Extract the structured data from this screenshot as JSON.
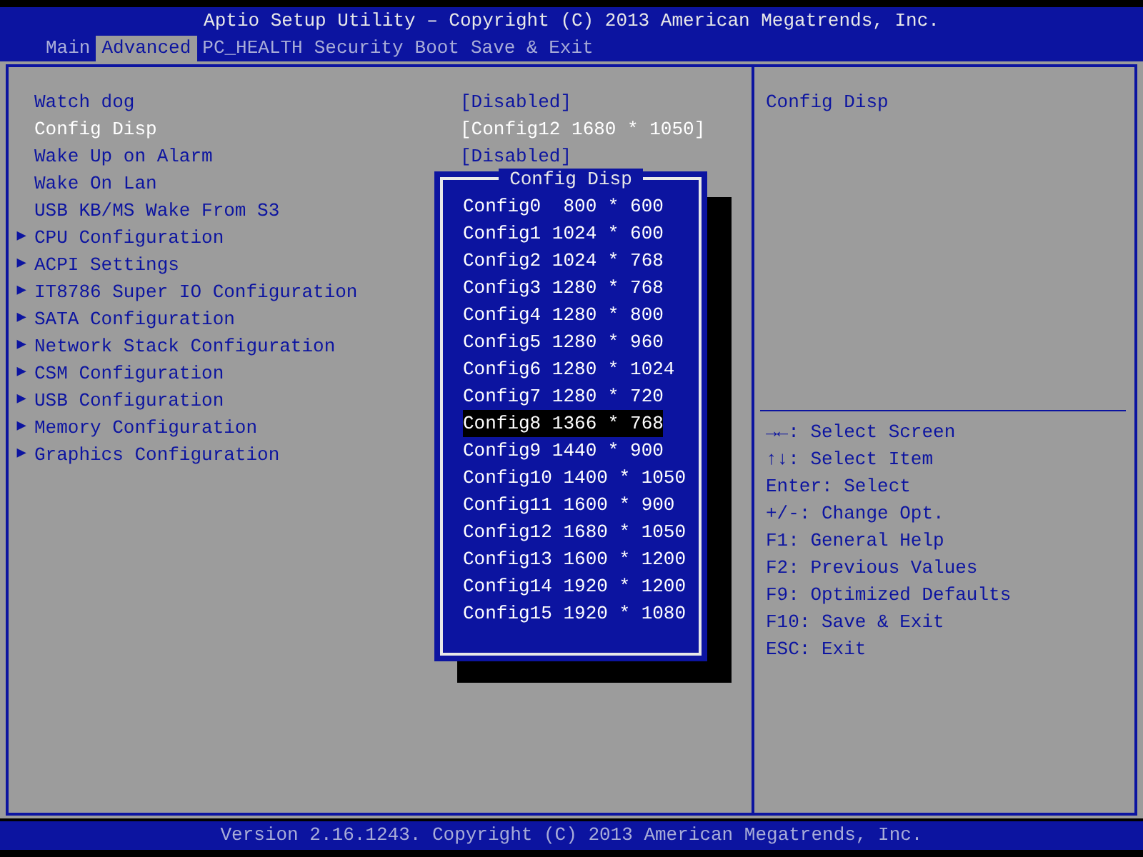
{
  "window": {
    "title": "Aptio Setup Utility – Copyright (C) 2013 American Megatrends, Inc."
  },
  "tabs": [
    {
      "label": "Main",
      "selected": false
    },
    {
      "label": "Advanced",
      "selected": true
    },
    {
      "label": "PC_HEALTH",
      "selected": false
    },
    {
      "label": "Security",
      "selected": false
    },
    {
      "label": "Boot",
      "selected": false
    },
    {
      "label": "Save & Exit",
      "selected": false
    }
  ],
  "settings": [
    {
      "kind": "setting",
      "label": "Watch dog",
      "value": "[Disabled]",
      "selected": false
    },
    {
      "kind": "setting",
      "label": "Config Disp",
      "value": "[Config12 1680 * 1050]",
      "selected": true
    },
    {
      "kind": "setting",
      "label": "Wake Up on Alarm",
      "value": "[Disabled]",
      "selected": false
    },
    {
      "kind": "setting",
      "label": "Wake On Lan",
      "selected": false
    },
    {
      "kind": "setting",
      "label": "USB KB/MS Wake From S3",
      "selected": false
    },
    {
      "kind": "submenu",
      "label": "CPU Configuration",
      "arrow": "▶",
      "selected": false
    },
    {
      "kind": "submenu",
      "label": "ACPI Settings",
      "arrow": "▶",
      "selected": false
    },
    {
      "kind": "submenu",
      "label": "IT8786 Super IO Configuration",
      "arrow": "▶",
      "selected": false
    },
    {
      "kind": "submenu",
      "label": "SATA Configuration",
      "arrow": "▶",
      "selected": false
    },
    {
      "kind": "submenu",
      "label": "Network Stack Configuration",
      "arrow": "▶",
      "selected": false
    },
    {
      "kind": "submenu",
      "label": "CSM Configuration",
      "arrow": "▶",
      "selected": false
    },
    {
      "kind": "submenu",
      "label": "USB Configuration",
      "arrow": "▶",
      "selected": false
    },
    {
      "kind": "submenu",
      "label": "Memory Configuration",
      "arrow": "▶",
      "selected": false
    },
    {
      "kind": "submenu",
      "label": "Graphics Configuration",
      "arrow": "▶",
      "selected": false
    }
  ],
  "popup": {
    "title": "Config Disp",
    "options": [
      {
        "label": "Config0  800 * 600",
        "selected": false
      },
      {
        "label": "Config1 1024 * 600",
        "selected": false
      },
      {
        "label": "Config2 1024 * 768",
        "selected": false
      },
      {
        "label": "Config3 1280 * 768",
        "selected": false
      },
      {
        "label": "Config4 1280 * 800",
        "selected": false
      },
      {
        "label": "Config5 1280 * 960",
        "selected": false
      },
      {
        "label": "Config6 1280 * 1024",
        "selected": false
      },
      {
        "label": "Config7 1280 * 720",
        "selected": false
      },
      {
        "label": "Config8 1366 * 768",
        "selected": true
      },
      {
        "label": "Config9 1440 * 900",
        "selected": false
      },
      {
        "label": "Config10 1400 * 1050",
        "selected": false
      },
      {
        "label": "Config11 1600 * 900",
        "selected": false
      },
      {
        "label": "Config12 1680 * 1050",
        "selected": false
      },
      {
        "label": "Config13 1600 * 1200",
        "selected": false
      },
      {
        "label": "Config14 1920 * 1200",
        "selected": false
      },
      {
        "label": "Config15 1920 * 1080",
        "selected": false
      }
    ]
  },
  "help": {
    "description": "Config Disp",
    "keys": [
      "→←: Select Screen",
      "↑↓: Select Item",
      "Enter: Select",
      "+/-: Change Opt.",
      "F1: General Help",
      "F2: Previous Values",
      "F9: Optimized Defaults",
      "F10: Save & Exit",
      "ESC: Exit"
    ]
  },
  "status_bar": "Version 2.16.1243. Copyright (C) 2013 American Megatrends, Inc."
}
